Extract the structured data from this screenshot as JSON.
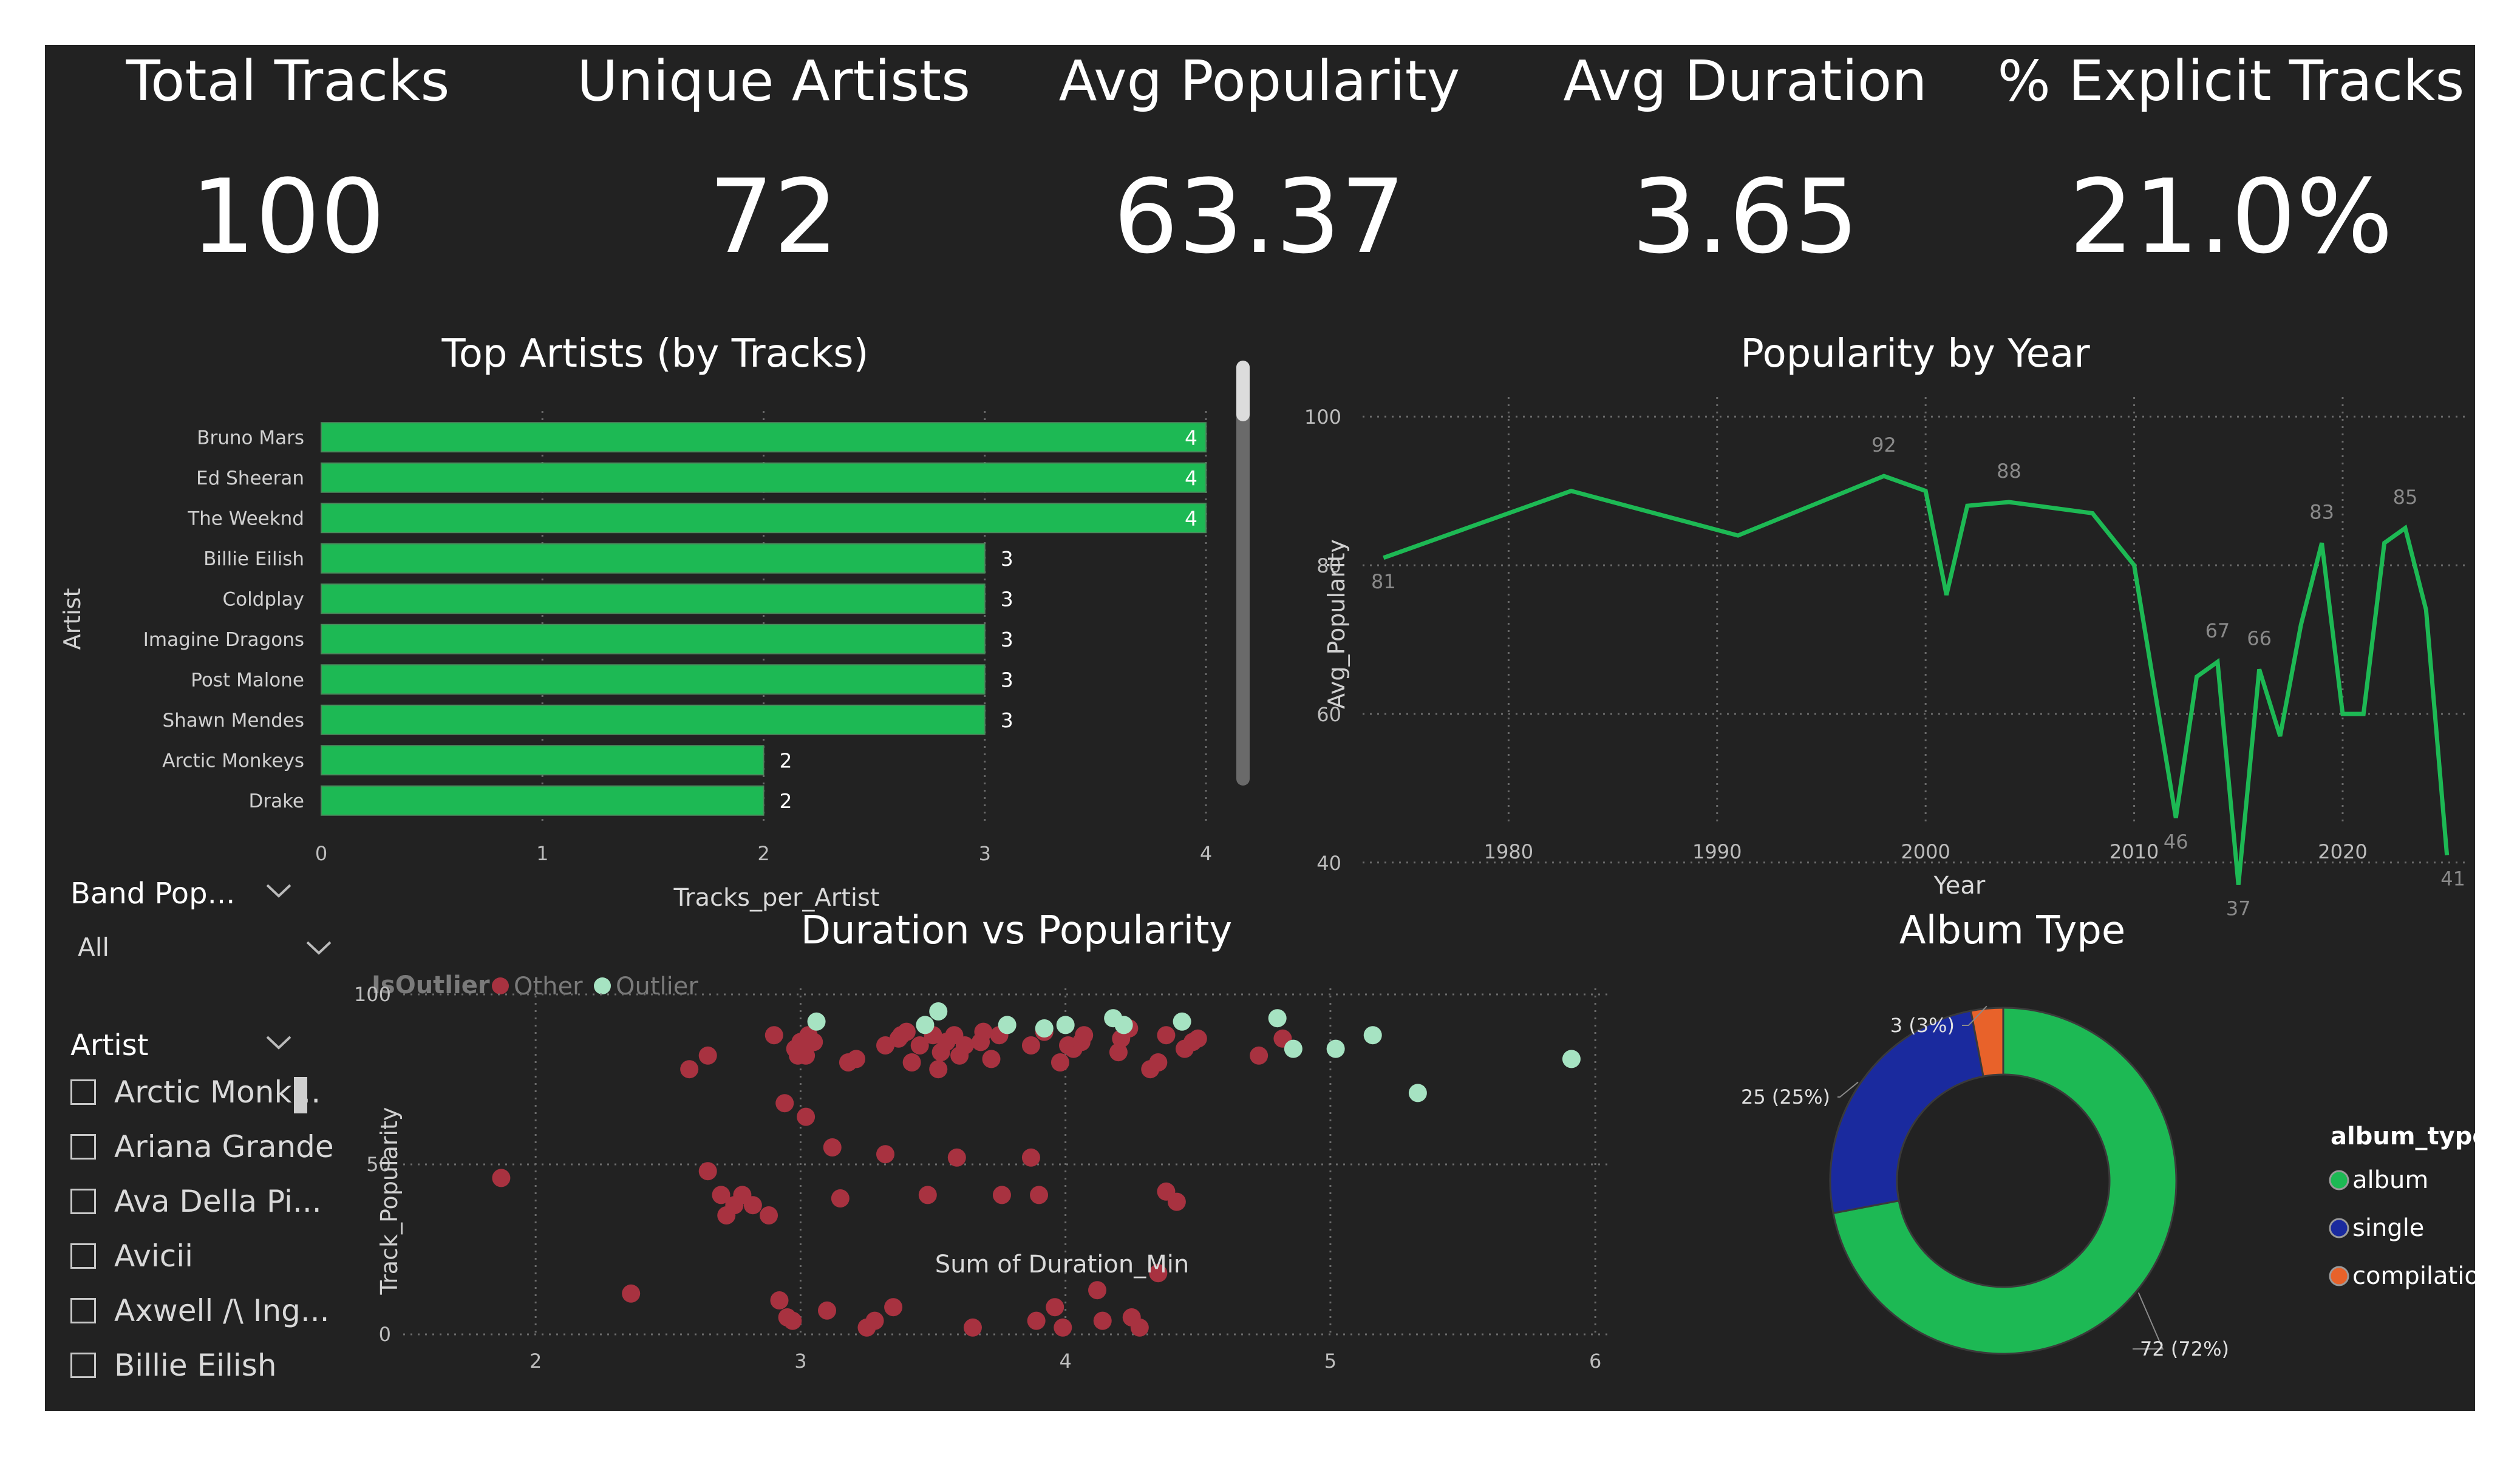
{
  "kpis": [
    {
      "title": "Total Tracks",
      "value": "100"
    },
    {
      "title": "Unique Artists",
      "value": "72"
    },
    {
      "title": "Avg Popularity",
      "value": "63.37"
    },
    {
      "title": "Avg Duration",
      "value": "3.65"
    },
    {
      "title": "% Explicit Tracks",
      "value": "21.0%"
    }
  ],
  "slicers": {
    "band_popularity": {
      "title": "Band Pop...",
      "value": "All"
    },
    "artist": {
      "title": "Artist",
      "items": [
        "Arctic Monk...",
        "Ariana Grande",
        "Ava Della Pi...",
        "Avicii",
        "Axwell /\\ Ing...",
        "Billie Eilish"
      ]
    }
  },
  "colors": {
    "background": "#222222",
    "bar": "#1DB954",
    "line": "#1DB954",
    "other": "#A83240",
    "outlier": "#A6E3C2",
    "album": "#1DB954",
    "single": "#1A2A9E",
    "compilation": "#E8622A"
  },
  "chart_data": [
    {
      "type": "bar",
      "title": "Top Artists (by Tracks)",
      "xlabel": "Tracks_per_Artist",
      "ylabel": "Artist",
      "categories": [
        "Bruno Mars",
        "Ed Sheeran",
        "The Weeknd",
        "Billie Eilish",
        "Coldplay",
        "Imagine Dragons",
        "Post Malone",
        "Shawn Mendes",
        "Arctic Monkeys",
        "Drake"
      ],
      "values": [
        4,
        4,
        4,
        3,
        3,
        3,
        3,
        3,
        2,
        2
      ],
      "xlim": [
        0,
        4
      ],
      "xticks": [
        "0",
        "1",
        "2",
        "3",
        "4"
      ],
      "orientation": "horizontal",
      "grid": true
    },
    {
      "type": "line",
      "title": "Popularity by Year",
      "xlabel": "Year",
      "ylabel": "Avg_Popularity",
      "x": [
        1974,
        1983,
        1991,
        1998,
        2000,
        2001,
        2002,
        2004,
        2008,
        2010,
        2012,
        2013,
        2014,
        2015,
        2016,
        2017,
        2018,
        2019,
        2020,
        2021,
        2022,
        2023,
        2024,
        2025
      ],
      "y": [
        81,
        90,
        84,
        92,
        90,
        76,
        88,
        88.5,
        87,
        80,
        46,
        65,
        67,
        37,
        66,
        57,
        72,
        83,
        60,
        60,
        83,
        85,
        74,
        41
      ],
      "point_labels": [
        {
          "x": 1974,
          "text": "81"
        },
        {
          "x": 1998,
          "text": "92"
        },
        {
          "x": 2004,
          "text": "88"
        },
        {
          "x": 2012,
          "text": "46"
        },
        {
          "x": 2014,
          "text": "67"
        },
        {
          "x": 2015,
          "text": "37"
        },
        {
          "x": 2016,
          "text": "66"
        },
        {
          "x": 2019,
          "text": "83"
        },
        {
          "x": 2023,
          "text": "85"
        },
        {
          "x": 2025,
          "text": "41"
        }
      ],
      "xlim": [
        1973,
        2026
      ],
      "ylim": [
        35,
        101
      ],
      "xticks": [
        1980,
        1990,
        2000,
        2010,
        2020
      ],
      "yticks": [
        40,
        60,
        80,
        100
      ],
      "grid": true
    },
    {
      "type": "scatter",
      "title": "Duration vs Popularity",
      "xlabel": "Sum of Duration_Min",
      "ylabel": "Track_Popularity",
      "legend_title": "IsOutlier",
      "legend_position": "top-left",
      "xlim": [
        1.5,
        6.05
      ],
      "ylim": [
        0,
        100
      ],
      "xticks": [
        2,
        3,
        4,
        5,
        6
      ],
      "yticks": [
        0,
        50,
        100
      ],
      "series": [
        {
          "name": "Other",
          "points": [
            [
              1.87,
              46
            ],
            [
              2.36,
              12
            ],
            [
              2.58,
              78
            ],
            [
              2.65,
              82
            ],
            [
              2.65,
              48
            ],
            [
              2.7,
              41
            ],
            [
              2.72,
              35
            ],
            [
              2.75,
              38
            ],
            [
              2.78,
              41
            ],
            [
              2.82,
              38
            ],
            [
              2.88,
              35
            ],
            [
              2.9,
              88
            ],
            [
              2.92,
              10
            ],
            [
              2.94,
              68
            ],
            [
              2.95,
              5
            ],
            [
              2.97,
              4
            ],
            [
              2.98,
              84
            ],
            [
              2.99,
              82
            ],
            [
              3.0,
              86
            ],
            [
              3.02,
              64
            ],
            [
              3.02,
              82
            ],
            [
              3.03,
              88
            ],
            [
              3.05,
              86
            ],
            [
              3.1,
              7
            ],
            [
              3.12,
              55
            ],
            [
              3.15,
              40
            ],
            [
              3.18,
              80
            ],
            [
              3.21,
              81
            ],
            [
              3.25,
              2
            ],
            [
              3.28,
              4
            ],
            [
              3.32,
              53
            ],
            [
              3.32,
              85
            ],
            [
              3.35,
              8
            ],
            [
              3.37,
              87
            ],
            [
              3.38,
              88
            ],
            [
              3.4,
              89
            ],
            [
              3.42,
              80
            ],
            [
              3.45,
              85
            ],
            [
              3.48,
              41
            ],
            [
              3.5,
              88
            ],
            [
              3.52,
              78
            ],
            [
              3.53,
              83
            ],
            [
              3.55,
              86
            ],
            [
              3.58,
              88
            ],
            [
              3.59,
              52
            ],
            [
              3.6,
              82
            ],
            [
              3.62,
              85
            ],
            [
              3.65,
              2
            ],
            [
              3.68,
              86
            ],
            [
              3.69,
              89
            ],
            [
              3.72,
              81
            ],
            [
              3.75,
              88
            ],
            [
              3.76,
              41
            ],
            [
              3.87,
              52
            ],
            [
              3.87,
              85
            ],
            [
              3.89,
              4
            ],
            [
              3.9,
              41
            ],
            [
              3.92,
              89
            ],
            [
              3.96,
              8
            ],
            [
              3.98,
              80
            ],
            [
              3.99,
              2
            ],
            [
              4.01,
              85
            ],
            [
              4.03,
              84
            ],
            [
              4.06,
              86
            ],
            [
              4.07,
              88
            ],
            [
              4.12,
              13
            ],
            [
              4.14,
              4
            ],
            [
              4.2,
              83
            ],
            [
              4.21,
              87
            ],
            [
              4.24,
              90
            ],
            [
              4.25,
              5
            ],
            [
              4.28,
              2
            ],
            [
              4.32,
              78
            ],
            [
              4.35,
              80
            ],
            [
              4.35,
              18
            ],
            [
              4.38,
              88
            ],
            [
              4.38,
              42
            ],
            [
              4.42,
              39
            ],
            [
              4.45,
              84
            ],
            [
              4.48,
              86
            ],
            [
              4.5,
              87
            ],
            [
              4.73,
              82
            ],
            [
              4.82,
              87
            ]
          ]
        },
        {
          "name": "Outlier",
          "points": [
            [
              3.06,
              92
            ],
            [
              3.47,
              91
            ],
            [
              3.52,
              95
            ],
            [
              3.78,
              91
            ],
            [
              3.92,
              90
            ],
            [
              4.0,
              91
            ],
            [
              4.18,
              93
            ],
            [
              4.22,
              91
            ],
            [
              4.44,
              92
            ],
            [
              4.8,
              93
            ],
            [
              4.86,
              84
            ],
            [
              5.02,
              84
            ],
            [
              5.16,
              88
            ],
            [
              5.33,
              71
            ],
            [
              5.91,
              81
            ]
          ]
        }
      ]
    },
    {
      "type": "pie",
      "title": "Album Type",
      "legend_title": "album_type",
      "legend_position": "right",
      "labels": [
        "album",
        "single",
        "compilation"
      ],
      "values": [
        72,
        25,
        3
      ],
      "data_labels": [
        "72 (72%)",
        "25 (25%)",
        "3 (3%)"
      ],
      "donut": true
    }
  ]
}
